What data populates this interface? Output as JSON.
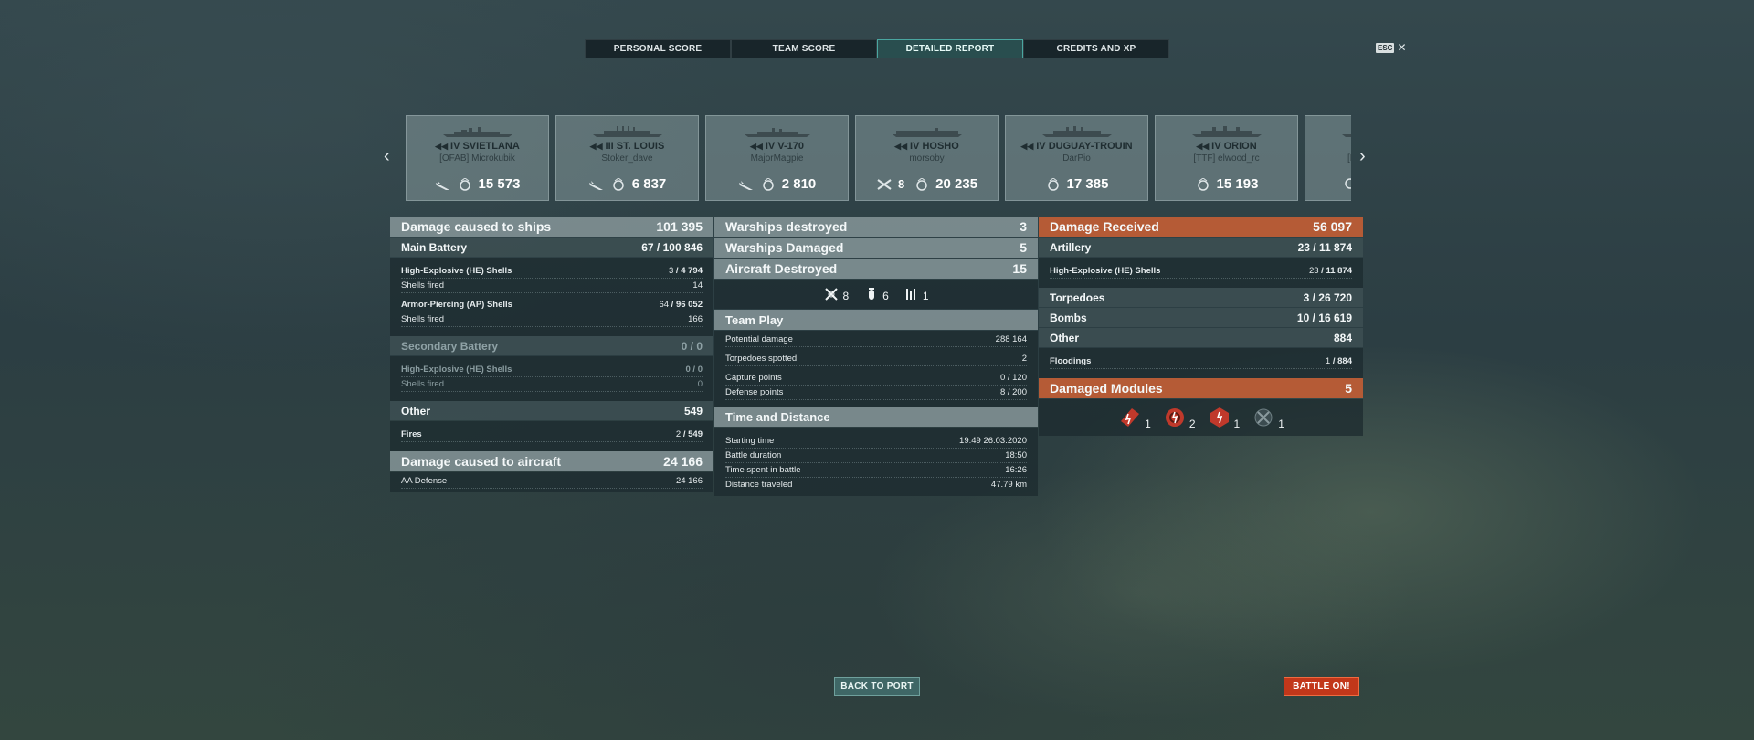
{
  "tabs": [
    {
      "label": "PERSONAL SCORE"
    },
    {
      "label": "TEAM SCORE"
    },
    {
      "label": "DETAILED REPORT",
      "active": true
    },
    {
      "label": "CREDITS AND XP"
    }
  ],
  "esc": {
    "key": "ESC",
    "close": "✕"
  },
  "carousel": {
    "prev": "‹",
    "next": "›",
    "ships": [
      {
        "tier_name": "IV SVIETLANA",
        "player": "[OFAB] Microkubik",
        "frags": "",
        "damage": "15 573"
      },
      {
        "tier_name": "III ST. LOUIS",
        "player": "Stoker_dave",
        "frags": "",
        "damage": "6 837"
      },
      {
        "tier_name": "IV V-170",
        "player": "MajorMagpie",
        "frags": "",
        "damage": "2 810"
      },
      {
        "tier_name": "IV HOSHO",
        "player": "morsoby",
        "frags": "8",
        "damage": "20 235"
      },
      {
        "tier_name": "IV DUGUAY-TROUIN",
        "player": "DarPio",
        "frags": "",
        "damage": "17 385"
      },
      {
        "tier_name": "IV ORION",
        "player": "[TTF] elwood_rc",
        "frags": "",
        "damage": "15 193"
      },
      {
        "tier_name": "",
        "player": "[M",
        "frags": "",
        "damage": ""
      }
    ]
  },
  "damage_caused": {
    "title": "Damage caused to ships",
    "total": "101 395",
    "main_battery": {
      "label": "Main Battery",
      "hits": "67",
      "damage": "100 846"
    },
    "he_shells": {
      "label": "High-Explosive (HE) Shells",
      "hits": "3",
      "damage": "4 794"
    },
    "he_fired": {
      "label": "Shells fired",
      "value": "14"
    },
    "ap_shells": {
      "label": "Armor-Piercing (AP) Shells",
      "hits": "64",
      "damage": "96 052"
    },
    "ap_fired": {
      "label": "Shells fired",
      "value": "166"
    },
    "secondary": {
      "label": "Secondary Battery",
      "hits": "0",
      "damage": "0"
    },
    "sec_he": {
      "label": "High-Explosive (HE) Shells",
      "hits": "0",
      "damage": "0"
    },
    "sec_fired": {
      "label": "Shells fired",
      "value": "0"
    },
    "other": {
      "label": "Other",
      "value": "549"
    },
    "fires": {
      "label": "Fires",
      "hits": "2",
      "damage": "549"
    },
    "aircraft": {
      "label": "Damage caused to aircraft",
      "value": "24 166"
    },
    "aa": {
      "label": "AA Defense",
      "value": "24 166"
    }
  },
  "destroyed": {
    "warships_destroyed": {
      "label": "Warships destroyed",
      "value": "3"
    },
    "warships_damaged": {
      "label": "Warships Damaged",
      "value": "5"
    },
    "aircraft_destroyed": {
      "label": "Aircraft Destroyed",
      "value": "15"
    },
    "icons": [
      {
        "name": "fighter-kill-icon",
        "value": "8"
      },
      {
        "name": "bomb-icon",
        "value": "6"
      },
      {
        "name": "torpedo-bomber-icon",
        "value": "1"
      }
    ]
  },
  "team_play": {
    "title": "Team Play",
    "rows": [
      {
        "label": "Potential damage",
        "value": "288 164"
      },
      {
        "label": "Torpedoes spotted",
        "value": "2"
      },
      {
        "label": "Capture points",
        "value": "0 / 120"
      },
      {
        "label": "Defense points",
        "value": "8 / 200"
      }
    ]
  },
  "time_distance": {
    "title": "Time and Distance",
    "rows": [
      {
        "label": "Starting time",
        "value": "19:49  26.03.2020"
      },
      {
        "label": "Battle duration",
        "value": "18:50"
      },
      {
        "label": "Time spent in battle",
        "value": "16:26"
      },
      {
        "label": "Distance traveled",
        "value": "47.79 km"
      }
    ]
  },
  "damage_received": {
    "title": "Damage Received",
    "total": "56 097",
    "artillery": {
      "label": "Artillery",
      "hits": "23",
      "damage": "11 874"
    },
    "he_shells": {
      "label": "High-Explosive (HE) Shells",
      "hits": "23",
      "damage": "11 874"
    },
    "torpedoes": {
      "label": "Torpedoes",
      "hits": "3",
      "damage": "26 720"
    },
    "bombs": {
      "label": "Bombs",
      "hits": "10",
      "damage": "16 619"
    },
    "other": {
      "label": "Other",
      "value": "884"
    },
    "floodings": {
      "label": "Floodings",
      "hits": "1",
      "damage": "884"
    },
    "modules": {
      "label": "Damaged Modules",
      "value": "5"
    },
    "module_icons": [
      {
        "name": "engine-icon",
        "value": "1"
      },
      {
        "name": "steering-icon",
        "value": "2"
      },
      {
        "name": "turret-icon",
        "value": "1"
      },
      {
        "name": "aa-mount-icon",
        "value": "1"
      }
    ]
  },
  "buttons": {
    "back": "BACK TO PORT",
    "battle": "BATTLE ON!"
  },
  "colors": {
    "accent": "#4aa6a0",
    "orange": "#b55b36",
    "battle": "#c2371a"
  }
}
